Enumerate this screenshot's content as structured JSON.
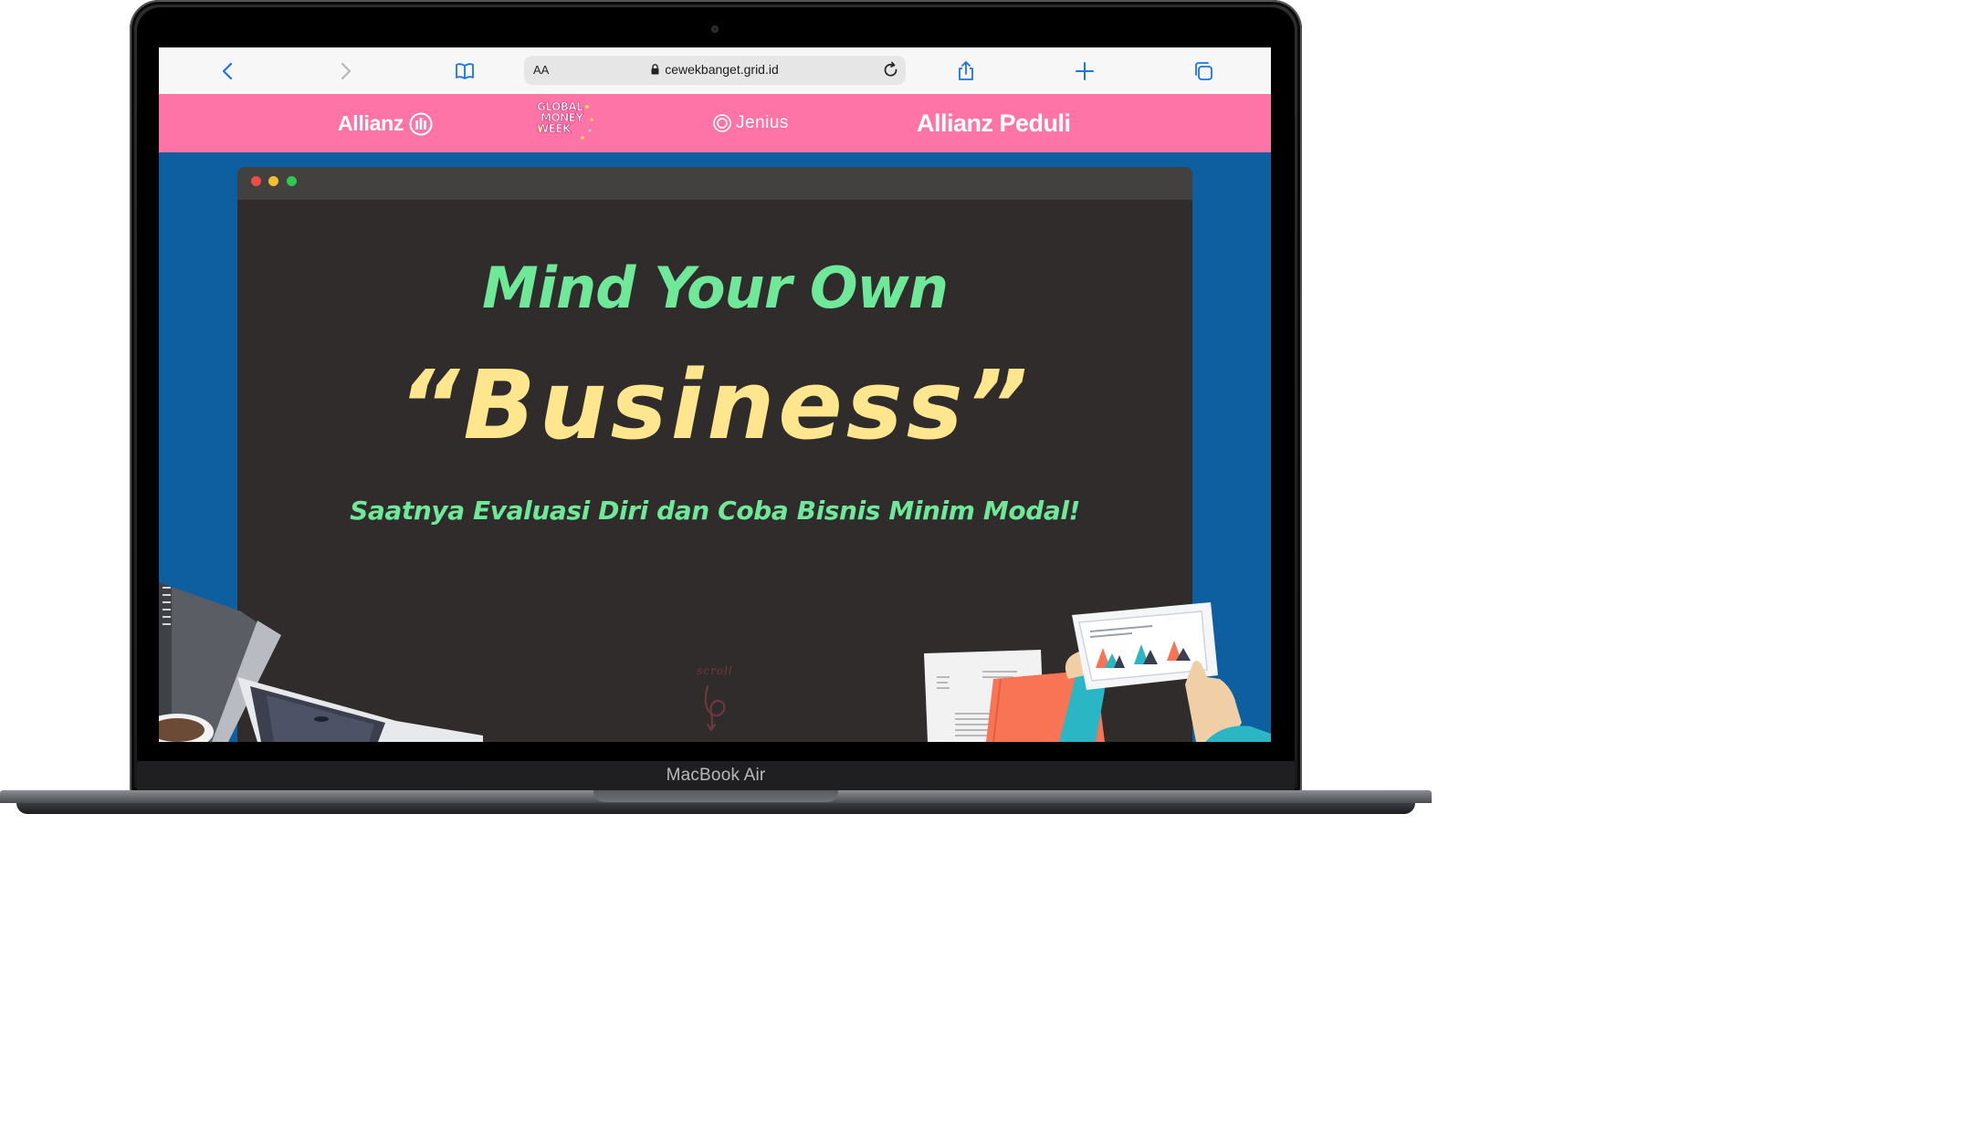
{
  "device": {
    "model_label": "MacBook Air"
  },
  "browser": {
    "address_bar": {
      "text_size_label": "AA",
      "url": "cewekbanget.grid.id"
    },
    "toolbar_icons": [
      "back-icon",
      "forward-icon",
      "bookmarks-icon",
      "reload-icon",
      "share-icon",
      "new-tab-icon",
      "tabs-icon"
    ]
  },
  "sponsors": {
    "allianz": "Allianz",
    "global_money_week": [
      "GLOBAL",
      "MONEY",
      "WEEK"
    ],
    "jenius": "Jenius",
    "allianz_peduli": "Allianz Peduli",
    "bar_color": "#fe74a6"
  },
  "hero": {
    "line1": "Mind Your Own",
    "line2": "“Business”",
    "line3": "Saatnya Evaluasi Diri dan Coba Bisnis Minim Modal!",
    "scroll_hint": "scroll",
    "colors": {
      "green": "#6fe89a",
      "yellow": "#fde68d",
      "panel": "#312c2c",
      "page_bg": "#0e5fa0"
    }
  }
}
